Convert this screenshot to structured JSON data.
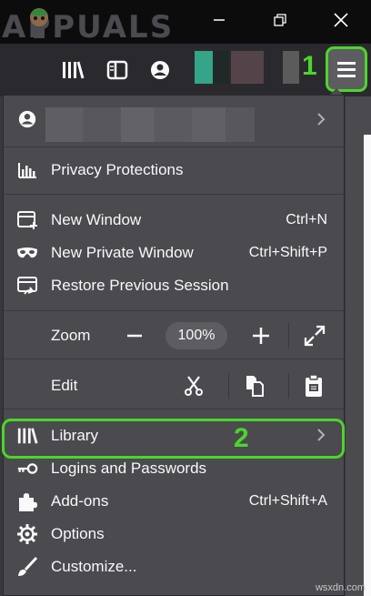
{
  "window": {
    "watermark_text": "APPUALS",
    "minimize_icon": "minimize-icon",
    "restore_icon": "restore-icon",
    "close_icon": "close-icon"
  },
  "toolbar": {
    "icons": [
      "library-icon",
      "sidebar-icon",
      "account-icon"
    ],
    "swatch_colors": [
      "#47a38e",
      "#5a4b50",
      "#545454"
    ],
    "menu_icon": "hamburger-menu-icon",
    "callout_1": "1"
  },
  "menu": {
    "privacy": "Privacy Protections",
    "new_window": {
      "label": "New Window",
      "shortcut": "Ctrl+N"
    },
    "new_private": {
      "label": "New Private Window",
      "shortcut": "Ctrl+Shift+P"
    },
    "restore": "Restore Previous Session",
    "zoom": {
      "label": "Zoom",
      "value": "100%"
    },
    "edit": {
      "label": "Edit"
    },
    "library": "Library",
    "logins": "Logins and Passwords",
    "addons": {
      "label": "Add-ons",
      "shortcut": "Ctrl+Shift+A"
    },
    "options": "Options",
    "customize": "Customize...",
    "callout_2": "2"
  },
  "credit": "wsxdn.com",
  "colors": {
    "highlight": "#4cd62a",
    "menu_bg": "#4a4a4f",
    "toolbar_bg": "#2a2a2e",
    "titlebar_bg": "#0c0c0d"
  }
}
